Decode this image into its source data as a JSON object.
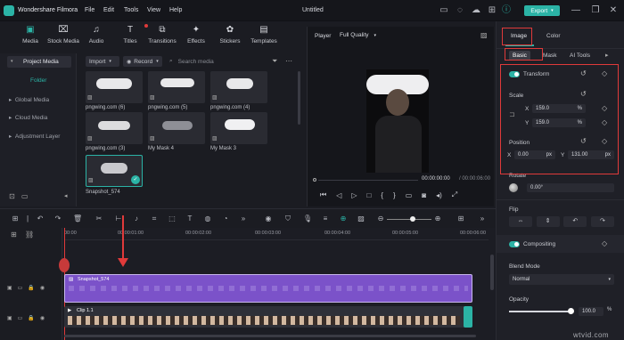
{
  "app": {
    "name": "Wondershare Filmora",
    "doc_title": "Untitled",
    "export_label": "Export"
  },
  "menu": [
    "File",
    "Edit",
    "Tools",
    "View",
    "Help"
  ],
  "media_tabs": [
    {
      "label": "Media",
      "icon": "media-icon"
    },
    {
      "label": "Stock Media",
      "icon": "stock-media-icon"
    },
    {
      "label": "Audio",
      "icon": "audio-icon"
    },
    {
      "label": "Titles",
      "icon": "titles-icon"
    },
    {
      "label": "Transitions",
      "icon": "transitions-icon"
    },
    {
      "label": "Effects",
      "icon": "effects-icon"
    },
    {
      "label": "Stickers",
      "icon": "stickers-icon"
    },
    {
      "label": "Templates",
      "icon": "templates-icon"
    }
  ],
  "sidebar": {
    "project_media": "Project Media",
    "folder": "Folder",
    "global_media": "Global Media",
    "cloud_media": "Cloud Media",
    "adjustment_layer": "Adjustment Layer"
  },
  "media_toolbar": {
    "import": "Import",
    "record": "Record",
    "search_placeholder": "Search media"
  },
  "media_items": [
    {
      "label": "pngwing.com (6)"
    },
    {
      "label": "pngwing.com (5)"
    },
    {
      "label": "pngwing.com (4)"
    },
    {
      "label": "pngwing.com (3)"
    },
    {
      "label": "My Mask 4"
    },
    {
      "label": "My Mask 3"
    },
    {
      "label": "Snapshot_574"
    }
  ],
  "player": {
    "label": "Player",
    "quality": "Full Quality",
    "current_time": "00:00:00:00",
    "total_time": "00:00:06:00"
  },
  "right_panel": {
    "tabs": [
      "Image",
      "Color"
    ],
    "subtabs": [
      "Basic",
      "Mask",
      "AI Tools"
    ],
    "transform": "Transform",
    "scale": "Scale",
    "scale_x": "159.0",
    "scale_y": "159.0",
    "percent": "%",
    "position": "Position",
    "pos_x": "0.00",
    "pos_y": "131.00",
    "px": "px",
    "rotate": "Rotate",
    "rotate_value": "0.00°",
    "flip": "Flip",
    "compositing": "Compositing",
    "blend_mode": "Blend Mode",
    "blend_value": "Normal",
    "opacity": "Opacity",
    "opacity_value": "100.0",
    "x_label": "X",
    "y_label": "Y"
  },
  "timeline": {
    "ruler": [
      "00:00",
      "00:00:01:00",
      "00:00:02:00",
      "00:00:03:00",
      "00:00:04:00",
      "00:00:05:00",
      "00:00:06:00"
    ],
    "track1_clip": "Snapshot_574",
    "track2_clip": "Clip 1.1"
  },
  "watermark": "wtvid.com",
  "colors": {
    "accent": "#2bb3a6",
    "highlight": "#e03a3a",
    "clip_purple": "#7b52c9"
  }
}
